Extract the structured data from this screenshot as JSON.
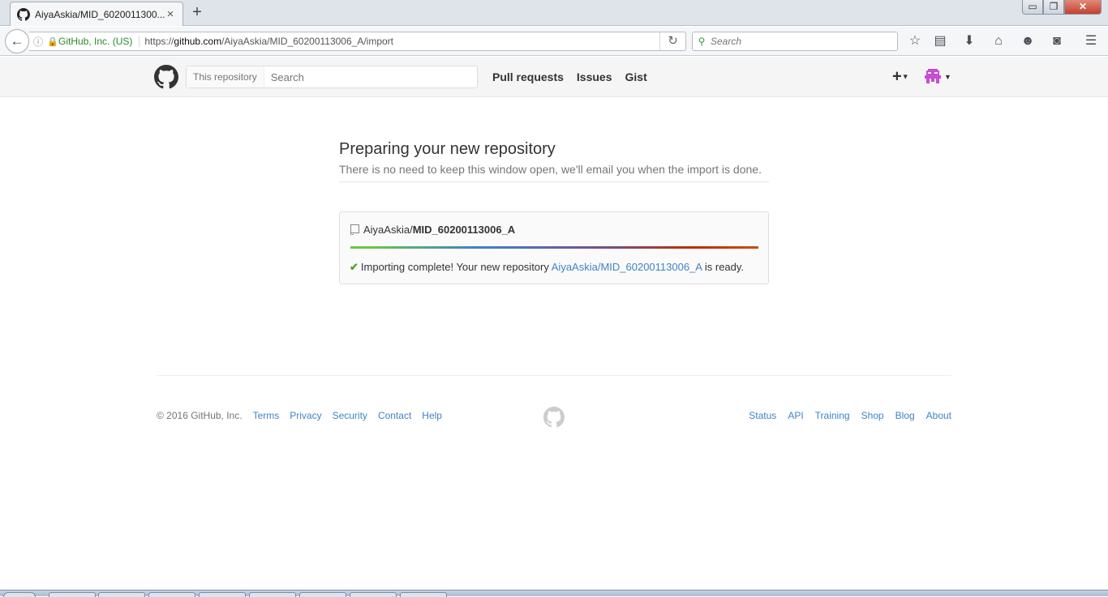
{
  "browser": {
    "tab_title": "AiyaAskia/MID_6020011300...",
    "tab_close": "×",
    "new_tab": "+",
    "window_controls": {
      "minimize": "▭",
      "maximize": "❐",
      "close": "✕"
    },
    "identity": "GitHub, Inc. (US)",
    "url_prefix": "https://",
    "url_host": "github.com",
    "url_path": "/AiyaAskia/MID_60200113006_A/import",
    "search_placeholder": "Search",
    "toolbar_icons": [
      "bookmark-star-icon",
      "reading-list-icon",
      "downloads-icon",
      "home-icon",
      "chat-icon",
      "pocket-icon",
      "menu-icon"
    ]
  },
  "header": {
    "scope_label": "This repository",
    "search_placeholder": "Search",
    "nav": [
      "Pull requests",
      "Issues",
      "Gist"
    ],
    "plus": "+"
  },
  "main": {
    "title": "Preparing your new repository",
    "lead": "There is no need to keep this window open, we'll email you when the import is done.",
    "repo_owner": "AiyaAskia/",
    "repo_name": "MID_60200113006_A",
    "progress_fraction": 1.0,
    "status_prefix": "Importing complete! Your new repository ",
    "status_link": "AiyaAskia/MID_60200113006_A",
    "status_suffix": " is ready."
  },
  "footer": {
    "copyright": "© 2016 GitHub, Inc.",
    "left_links": [
      "Terms",
      "Privacy",
      "Security",
      "Contact",
      "Help"
    ],
    "right_links": [
      "Status",
      "API",
      "Training",
      "Shop",
      "Blog",
      "About"
    ]
  },
  "colors": {
    "link": "#4183c4",
    "check": "#55a532",
    "header_bg": "#f5f5f5"
  }
}
